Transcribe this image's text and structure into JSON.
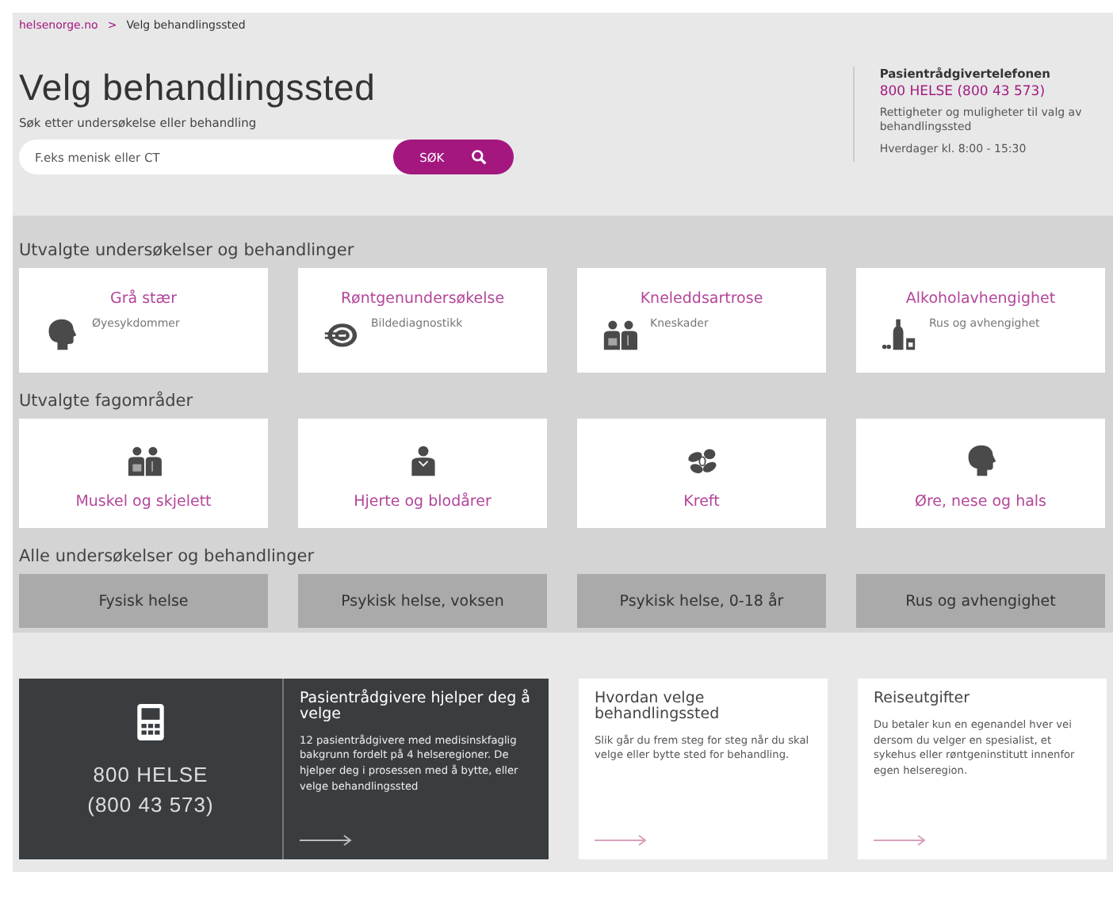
{
  "breadcrumb": [
    {
      "label": "helsenorge.no",
      "kind": "link"
    },
    {
      "label": "Velg behandlingssted",
      "kind": "current"
    }
  ],
  "breadcrumb_separator": ">",
  "title": "Velg behandlingssted",
  "search": {
    "label": "Søk etter undersøkelse eller behandling",
    "placeholder": "F.eks menisk eller CT",
    "button": "SØK"
  },
  "hotline": {
    "title": "Pasientrådgivertelefonen",
    "phone": "800 HELSE (800 43 573)",
    "text": "Rettigheter og muligheter til valg av behandlingssted",
    "hours": "Hverdager kl. 8:00 - 15:30"
  },
  "featured": {
    "heading": "Utvalgte undersøkelser og behandlinger",
    "items": [
      {
        "title": "Grå stær",
        "category": "Øyesykdommer",
        "kind": "head"
      },
      {
        "title": "Røntgenundersøkelse",
        "category": "Bildediagnostikk",
        "kind": "target"
      },
      {
        "title": "Kneleddsartrose",
        "category": "Kneskader",
        "kind": "people"
      },
      {
        "title": "Alkoholavhengighet",
        "category": "Rus og avhengighet",
        "kind": "bottle"
      }
    ]
  },
  "areas": {
    "heading": "Utvalgte fagområder",
    "items": [
      {
        "title": "Muskel og skjelett",
        "kind": "people"
      },
      {
        "title": "Hjerte og blodårer",
        "kind": "person"
      },
      {
        "title": "Kreft",
        "kind": "cells"
      },
      {
        "title": "Øre, nese og hals",
        "kind": "head"
      }
    ]
  },
  "all": {
    "heading": "Alle undersøkelser og behandlinger",
    "items": [
      "Fysisk helse",
      "Psykisk helse, voksen",
      "Psykisk helse, 0-18 år",
      "Rus og avhengighet"
    ]
  },
  "phone_card": {
    "number": "800 HELSE",
    "number_digits": "(800 43 573)",
    "title": "Pasientrådgivere hjelper deg å velge",
    "text": "12 pasientrådgivere med medisinskfaglig bakgrunn fordelt på 4 helseregioner. De hjelper deg i prosessen med å bytte, eller velge behandlingssted"
  },
  "info_cards": [
    {
      "title": "Hvordan velge behandlingssted",
      "text": "Slik går du frem steg for steg når du skal velge eller bytte sted for behandling."
    },
    {
      "title": "Reiseutgifter",
      "text": "Du betaler kun en egenandel hver vei dersom du velger en spesialist, et sykehus eller røntgeninstitutt innenfor egen helseregion."
    }
  ]
}
